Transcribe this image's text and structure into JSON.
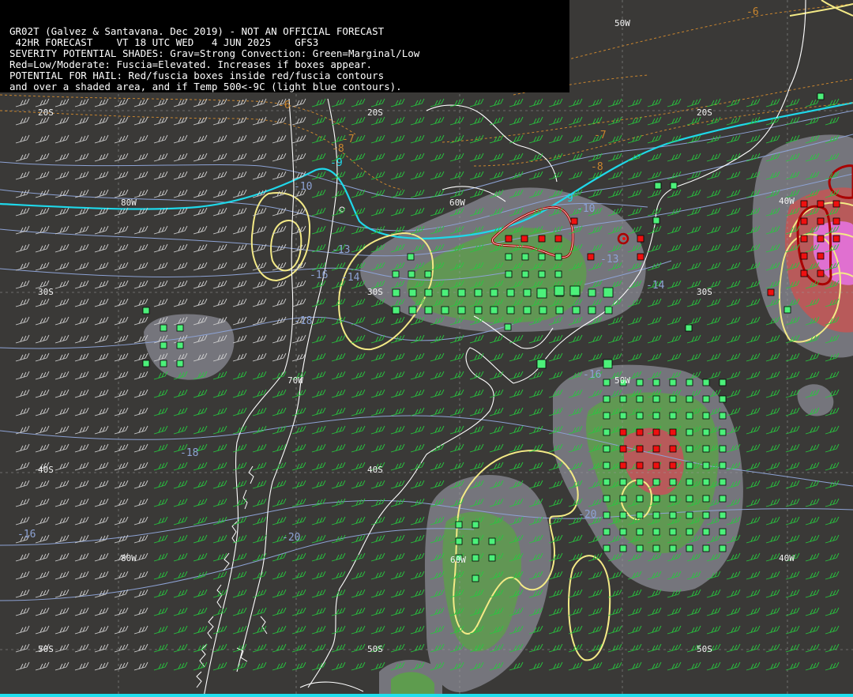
{
  "header": {
    "line1": "GR02T (Galvez & Santavana. Dec 2019) - NOT AN OFFICIAL FORECAST",
    "line2": " 42HR FORECAST    VT 18 UTC WED   4 JUN 2025    GFS3",
    "line3": "SEVERITY POTENTIAL SHADES: Grav=Strong Convection: Green=Marginal/Low",
    "line4": "Red=Low/Moderate: Fuscia=Elevated. Increases if boxes appear.",
    "line5": "POTENTIAL FOR HAIL: Red/fuscia boxes inside red/fuscia contours",
    "line6": "and over a shaded area, and if Temp 500<-9C (light blue contours)."
  },
  "grid_labels": {
    "lon50_top": "50W",
    "lat20_w": "20S",
    "lat20_mid": "20S",
    "lat20_e": "20S",
    "lon80_a": "80W",
    "lon60": "60W",
    "lon40_e": "40W",
    "lat30_w": "30S",
    "lat30_mid": "30S",
    "lat30_e": "30S",
    "lon70": "70W",
    "lon50_mid": "50W",
    "lat40_w": "40S",
    "lat40_mid": "40S",
    "lon60_low": "60W",
    "lon80_b": "80W",
    "lon40_low": "40W",
    "lat50_w": "50S",
    "lat50_mid": "50S",
    "lat50_e": "50S"
  },
  "temp_labels": {
    "t1": "-6",
    "t2": "-6",
    "t3": "-7",
    "t4": "-8",
    "t5": "-8",
    "t6": "-7",
    "t7": "-9",
    "t8": "-9",
    "t9": "-10",
    "t10": "-10",
    "t11": "-13",
    "t12": "-16",
    "t13": "-14",
    "t14": "-13",
    "t15": "-14",
    "t16": "-18",
    "t17": "-18",
    "t18": "-16",
    "t19": "-20",
    "t20": "-20",
    "t21": "-16"
  },
  "colors": {
    "background": "#3a3937",
    "coast": "#ffffff",
    "temp_contour": "#8da2d4",
    "minus9_contour": "#1fd8ea",
    "warm_contour": "#c9852e",
    "yellow_contour": "#f4ea86",
    "red_contour": "#b00000",
    "green_box": "#4cf07a",
    "red_box": "#ee1010",
    "wind_barb": "#27c83f",
    "wind_barb_plain": "#d0d0d0",
    "shade_gray": "#7b7b82",
    "shade_green": "#5e9c4e",
    "shade_red": "#b85a5a",
    "shade_fuscia": "#e070d0"
  }
}
